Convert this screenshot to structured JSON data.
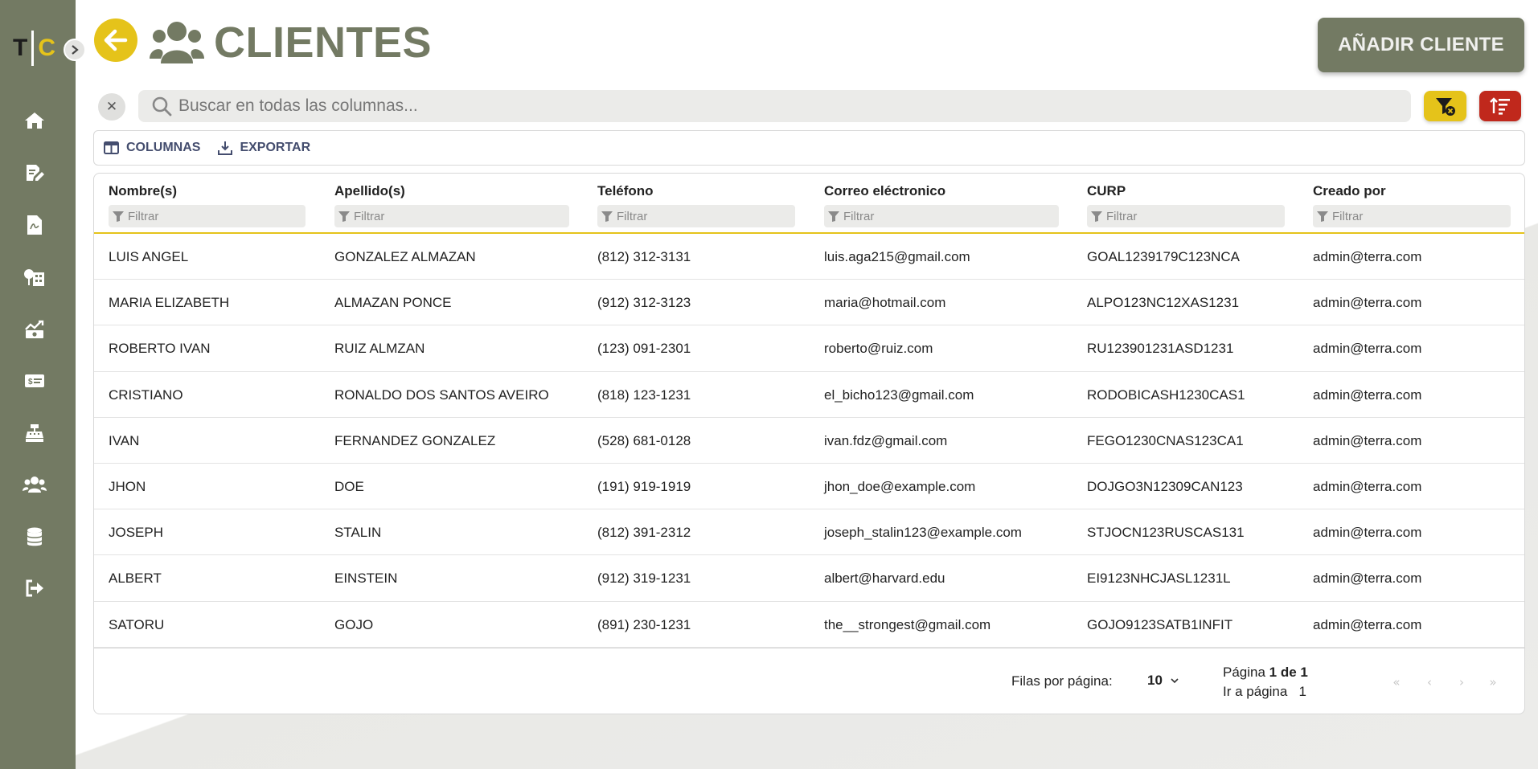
{
  "logo": {
    "t": "T",
    "c": "C"
  },
  "page": {
    "title": "CLIENTES"
  },
  "header": {
    "add_button": "AÑADIR CLIENTE"
  },
  "nav": {
    "items": [
      {
        "icon": "home-icon"
      },
      {
        "icon": "edit-document-icon"
      },
      {
        "icon": "pdf-document-icon"
      },
      {
        "icon": "buildings-icon"
      },
      {
        "icon": "chart-money-icon"
      },
      {
        "icon": "money-bill-icon"
      },
      {
        "icon": "cash-register-icon"
      },
      {
        "icon": "users-icon"
      },
      {
        "icon": "database-icon"
      },
      {
        "icon": "logout-icon"
      }
    ]
  },
  "search": {
    "placeholder": "Buscar en todas las columnas..."
  },
  "toolbar": {
    "columns_label": "COLUMNAS",
    "export_label": "EXPORTAR"
  },
  "table": {
    "filter_placeholder": "Filtrar",
    "columns": [
      "Nombre(s)",
      "Apellido(s)",
      "Teléfono",
      "Correo eléctronico",
      "CURP",
      "Creado por"
    ],
    "rows": [
      [
        "LUIS ANGEL",
        "GONZALEZ ALMAZAN",
        "(812) 312-3131",
        "luis.aga215@gmail.com",
        "GOAL1239179C123NCA",
        "admin@terra.com"
      ],
      [
        "MARIA ELIZABETH",
        "ALMAZAN PONCE",
        "(912) 312-3123",
        "maria@hotmail.com",
        "ALPO123NC12XAS1231",
        "admin@terra.com"
      ],
      [
        "ROBERTO IVAN",
        "RUIZ ALMZAN",
        "(123) 091-2301",
        "roberto@ruiz.com",
        "RU123901231ASD1231",
        "admin@terra.com"
      ],
      [
        "CRISTIANO",
        "RONALDO DOS SANTOS AVEIRO",
        "(818) 123-1231",
        "el_bicho123@gmail.com",
        "RODOBICASH1230CAS1",
        "admin@terra.com"
      ],
      [
        "IVAN",
        "FERNANDEZ GONZALEZ",
        "(528) 681-0128",
        "ivan.fdz@gmail.com",
        "FEGO1230CNAS123CA1",
        "admin@terra.com"
      ],
      [
        "JHON",
        "DOE",
        "(191) 919-1919",
        "jhon_doe@example.com",
        "DOJGO3N12309CAN123",
        "admin@terra.com"
      ],
      [
        "JOSEPH",
        "STALIN",
        "(812) 391-2312",
        "joseph_stalin123@example.com",
        "STJOCN123RUSCAS131",
        "admin@terra.com"
      ],
      [
        "ALBERT",
        "EINSTEIN",
        "(912) 319-1231",
        "albert@harvard.edu",
        "EI9123NHCJASL1231L",
        "admin@terra.com"
      ],
      [
        "SATORU",
        "GOJO",
        "(891) 230-1231",
        "the__strongest@gmail.com",
        "GOJO9123SATB1INFIT",
        "admin@terra.com"
      ]
    ]
  },
  "pagination": {
    "rows_per_page_label": "Filas por página:",
    "rows_per_page_value": "10",
    "page_label": "Página",
    "page_of": "1 de 1",
    "goto_label": "Ir a página",
    "goto_value": "1",
    "first": "«",
    "prev": "‹",
    "next": "›",
    "last": "»"
  },
  "colors": {
    "sidebar": "#737a63",
    "accent_yellow": "#e5c31a",
    "accent_red": "#c0281c",
    "title_olive": "#737a63"
  }
}
